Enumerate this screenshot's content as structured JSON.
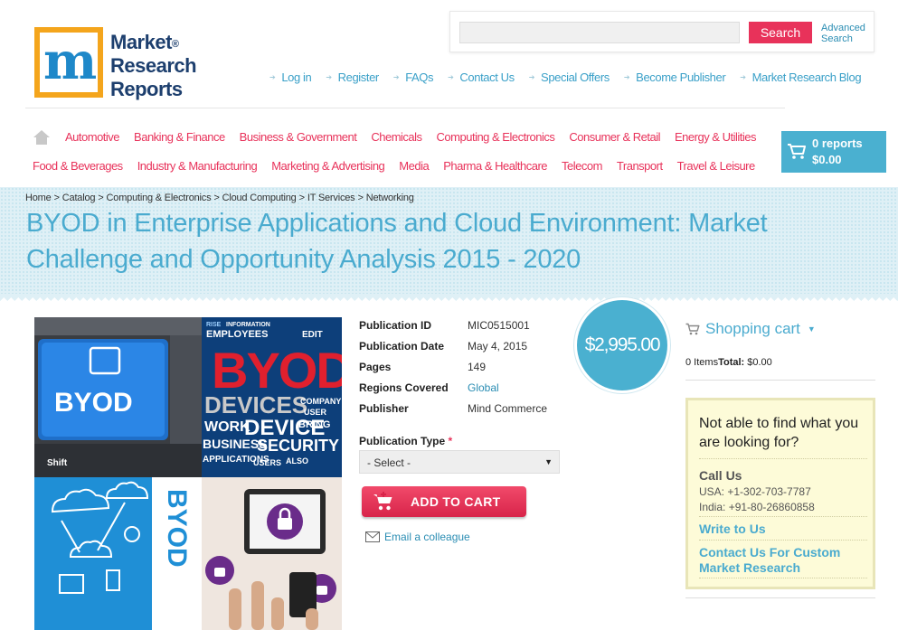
{
  "logo": {
    "line1": "Market",
    "line2": "Research",
    "line3": "Reports",
    "registered": "®"
  },
  "search": {
    "placeholder": "",
    "button_label": "Search",
    "advanced_line1": "Advanced",
    "advanced_line2": "Search"
  },
  "top_links": [
    "Log in",
    "Register",
    "FAQs",
    "Contact Us",
    "Special Offers",
    "Become Publisher",
    "Market Research Blog"
  ],
  "categories": {
    "row1": [
      "Automotive",
      "Banking & Finance",
      "Business & Government",
      "Chemicals",
      "Computing & Electronics",
      "Consumer & Retail",
      "Energy & Utilities"
    ],
    "row2": [
      "Food & Beverages",
      "Industry & Manufacturing",
      "Marketing & Advertising",
      "Media",
      "Pharma & Healthcare",
      "Telecom",
      "Transport",
      "Travel & Leisure"
    ]
  },
  "cart": {
    "reports": "0 reports",
    "total": "$0.00"
  },
  "breadcrumb": [
    "Home",
    "Catalog",
    "Computing & Electronics",
    "Cloud Computing",
    "IT Services",
    "Networking"
  ],
  "breadcrumb_sep": ">",
  "title_line1": "BYOD in Enterprise Applications and Cloud Environment: Market",
  "title_line2": "Challenge and Opportunity Analysis 2015 - 2020",
  "image_text": {
    "key_label": "BYOD",
    "shift_label": "Shift",
    "big_byod": "BYOD",
    "words": [
      "RISE",
      "INFORMATION",
      "EMPLOYEES",
      "EDIT",
      "DEVICES",
      "COMPANY",
      "USER",
      "WORK",
      "DEVICE",
      "BRING",
      "BUSINESS",
      "SECURITY",
      "APPLICATIONS",
      "USERS",
      "ALSO"
    ],
    "vertical_byod": "BYOD"
  },
  "details": {
    "rows": [
      {
        "label": "Publication ID",
        "value": "MIC0515001"
      },
      {
        "label": "Publication Date",
        "value": "May 4, 2015"
      },
      {
        "label": "Pages",
        "value": "149"
      },
      {
        "label": "Regions Covered",
        "value": "Global"
      },
      {
        "label": "Publisher",
        "value": "Mind Commerce"
      }
    ],
    "pub_type_label": "Publication Type",
    "required_mark": "*",
    "select_value": "- Select -",
    "add_to_cart": "ADD TO CART",
    "email_colleague": "Email a colleague"
  },
  "price": "$2,995.00",
  "shopping_cart": {
    "title": "Shopping cart",
    "items_label": "0 Items",
    "total_label": "Total:",
    "total_value": " $0.00"
  },
  "help": {
    "title": "Not able to find what you are looking for?",
    "call_us": "Call Us",
    "usa": "USA: +1-302-703-7787",
    "india": "India: +91-80-26860858",
    "write_to_us": "Write to Us",
    "contact_custom": "Contact Us For Custom Market Research"
  },
  "colors": {
    "accent_blue": "#4ab0d0",
    "accent_pink": "#e8325a",
    "logo_orange": "#f4a51c"
  }
}
